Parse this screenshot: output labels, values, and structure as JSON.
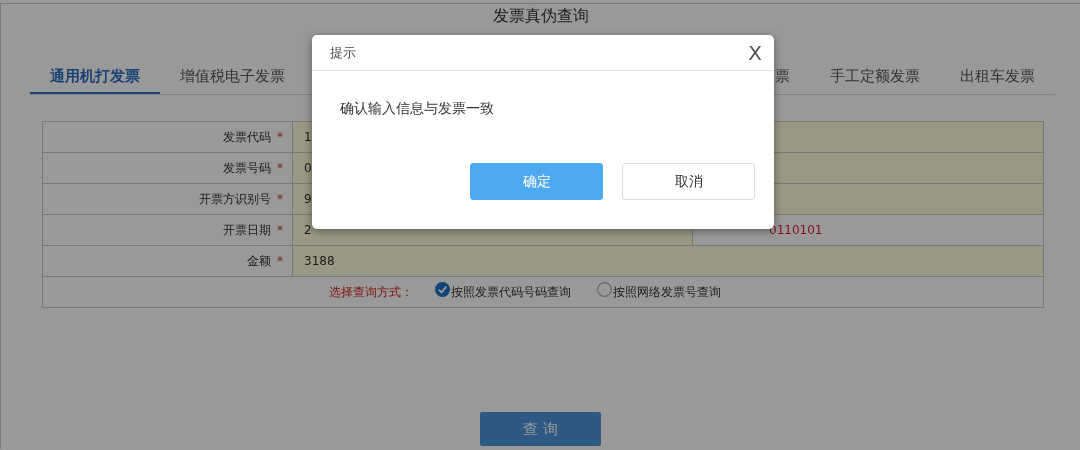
{
  "page": {
    "title": "发票真伪查询"
  },
  "tabs": [
    {
      "label": "通用机打发票",
      "selected": true
    },
    {
      "label": "增值税电子发票",
      "selected": false
    },
    {
      "label": "票",
      "selected": false
    },
    {
      "label": "手工定额发票",
      "selected": false
    },
    {
      "label": "出租车发票",
      "selected": false
    }
  ],
  "form": {
    "fields": [
      {
        "label": "发票代码",
        "required_mark": "*",
        "value": "1"
      },
      {
        "label": "发票号码",
        "required_mark": "*",
        "value": "0"
      },
      {
        "label": "开票方识别号",
        "required_mark": "*",
        "value": "9"
      },
      {
        "label": "开票日期",
        "required_mark": "*",
        "value": "2",
        "extra": "0110101"
      },
      {
        "label": "金额",
        "required_mark": "*",
        "value": "3188"
      }
    ],
    "query_mode": {
      "label": "选择查询方式：",
      "options": [
        {
          "label": "按照发票代码号码查询",
          "selected": true
        },
        {
          "label": "按照网络发票号查询",
          "selected": false
        }
      ]
    }
  },
  "query_button": "查 询",
  "dialog": {
    "title": "提示",
    "close": "X",
    "message": "确认输入信息与发票一致",
    "buttons": [
      {
        "label": "确定",
        "kind": "primary"
      },
      {
        "label": "取消",
        "kind": "secondary"
      }
    ]
  }
}
